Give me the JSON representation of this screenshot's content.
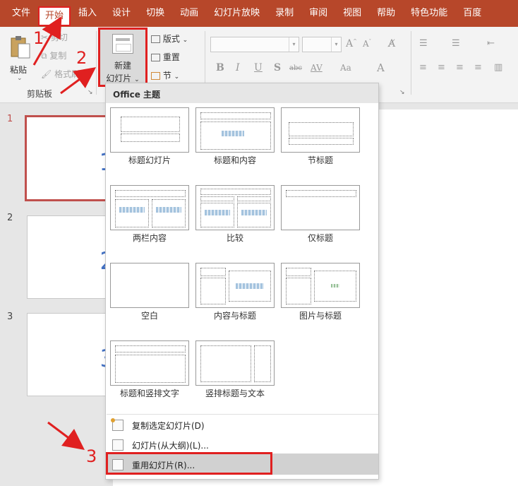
{
  "tabs": [
    "文件",
    "开始",
    "插入",
    "设计",
    "切换",
    "动画",
    "幻灯片放映",
    "录制",
    "审阅",
    "视图",
    "帮助",
    "特色功能",
    "百度"
  ],
  "active_tab_index": 1,
  "ribbon": {
    "clipboard": {
      "paste": "粘贴",
      "cut": "剪切",
      "copy": "复制",
      "format_painter": "格式刷",
      "group_label": "剪贴板"
    },
    "slides": {
      "new_slide_line1": "新建",
      "new_slide_line2": "幻灯片",
      "layout": "版式",
      "reset": "重置",
      "section": "节"
    },
    "font": {
      "bold": "B",
      "italic": "I",
      "underline": "U",
      "shadow": "S",
      "strikethrough": "abc",
      "spacing": "AV",
      "case": "Aa",
      "color": "A"
    }
  },
  "thumbnails": [
    {
      "num": "1",
      "big": "1",
      "selected": true
    },
    {
      "num": "2",
      "big": "2",
      "selected": false
    },
    {
      "num": "3",
      "big": "3",
      "selected": false
    }
  ],
  "dropdown": {
    "header": "Office 主题",
    "layouts": [
      "标题幻灯片",
      "标题和内容",
      "节标题",
      "两栏内容",
      "比较",
      "仅标题",
      "空白",
      "内容与标题",
      "图片与标题",
      "标题和竖排文字",
      "竖排标题与文本"
    ],
    "menu_items": [
      "复制选定幻灯片(D)",
      "幻灯片(从大纲)(L)...",
      "重用幻灯片(R)..."
    ]
  },
  "annotations": [
    "1",
    "2",
    "3"
  ],
  "colors": {
    "accent": "#b7472a",
    "highlight": "#e02020",
    "slide_number": "#4472c4"
  }
}
